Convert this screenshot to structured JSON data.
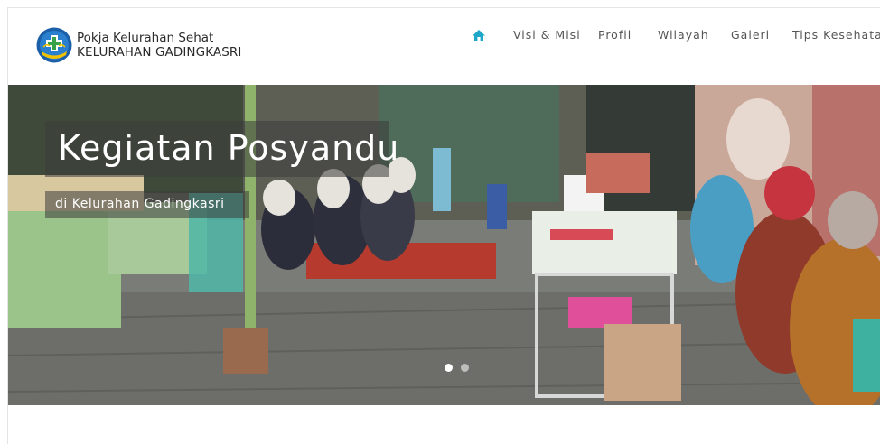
{
  "brand": {
    "title": "Pokja Kelurahan Sehat",
    "subtitle": "KELURAHAN GADINGKASRI",
    "logo_icon": "garuda-shield-logo"
  },
  "nav": {
    "home_icon": "home-icon",
    "accent": "#1fa7c9",
    "items": [
      {
        "label": "Visi & Misi"
      },
      {
        "label": "Profil"
      },
      {
        "label": "Wilayah"
      },
      {
        "label": "Galeri"
      },
      {
        "label": "Tips Kesehatan"
      }
    ]
  },
  "hero": {
    "title": "Kegiatan Posyandu",
    "subtitle": "di Kelurahan Gadingkasri",
    "slide_count": 2,
    "active_slide": 1
  }
}
